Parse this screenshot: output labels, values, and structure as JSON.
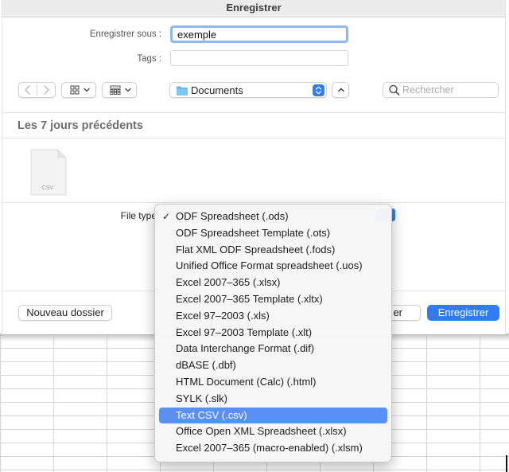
{
  "dialog": {
    "title": "Enregistrer",
    "save_as_label": "Enregistrer sous :",
    "save_as_value": "exemple",
    "tags_label": "Tags :",
    "location": "Documents",
    "search_placeholder": "Rechercher",
    "section_header": "Les 7 jours précédents",
    "file_item_label": "CSV",
    "file_type_label": "File type",
    "new_folder_label": "Nouveau dossier",
    "cancel_label": "er",
    "save_label": "Enregistrer"
  },
  "menu": {
    "checkmark": "✓",
    "items": [
      {
        "label": "ODF Spreadsheet (.ods)"
      },
      {
        "label": "ODF Spreadsheet Template (.ots)"
      },
      {
        "label": "Flat XML ODF Spreadsheet (.fods)"
      },
      {
        "label": "Unified Office Format spreadsheet (.uos)"
      },
      {
        "label": "Excel 2007–365 (.xlsx)"
      },
      {
        "label": "Excel 2007–365 Template (.xltx)"
      },
      {
        "label": "Excel 97–2003 (.xls)"
      },
      {
        "label": "Excel 97–2003 Template (.xlt)"
      },
      {
        "label": "Data Interchange Format (.dif)"
      },
      {
        "label": "dBASE (.dbf)"
      },
      {
        "label": "HTML Document (Calc) (.html)"
      },
      {
        "label": "SYLK (.slk)"
      },
      {
        "label": "Text CSV (.csv)"
      },
      {
        "label": "Office Open XML Spreadsheet (.xlsx)"
      },
      {
        "label": "Excel 2007–365 (macro-enabled) (.xlsm)"
      }
    ],
    "checked_index": 0,
    "highlighted_index": 12
  },
  "colors": {
    "accent": "#2f7cf6",
    "highlight": "#5a8ff4",
    "focus_ring": "#8fb6ef",
    "folder": "#5fb3ec"
  },
  "icons": {
    "back": "chevron-left-icon",
    "forward": "chevron-right-icon",
    "view": "icon-grid-icon",
    "group": "group-grid-icon",
    "folder": "folder-icon",
    "stepper": "stepper-arrows-icon",
    "collapse": "chevron-up-icon",
    "search": "magnifier-icon",
    "file": "document-icon"
  }
}
